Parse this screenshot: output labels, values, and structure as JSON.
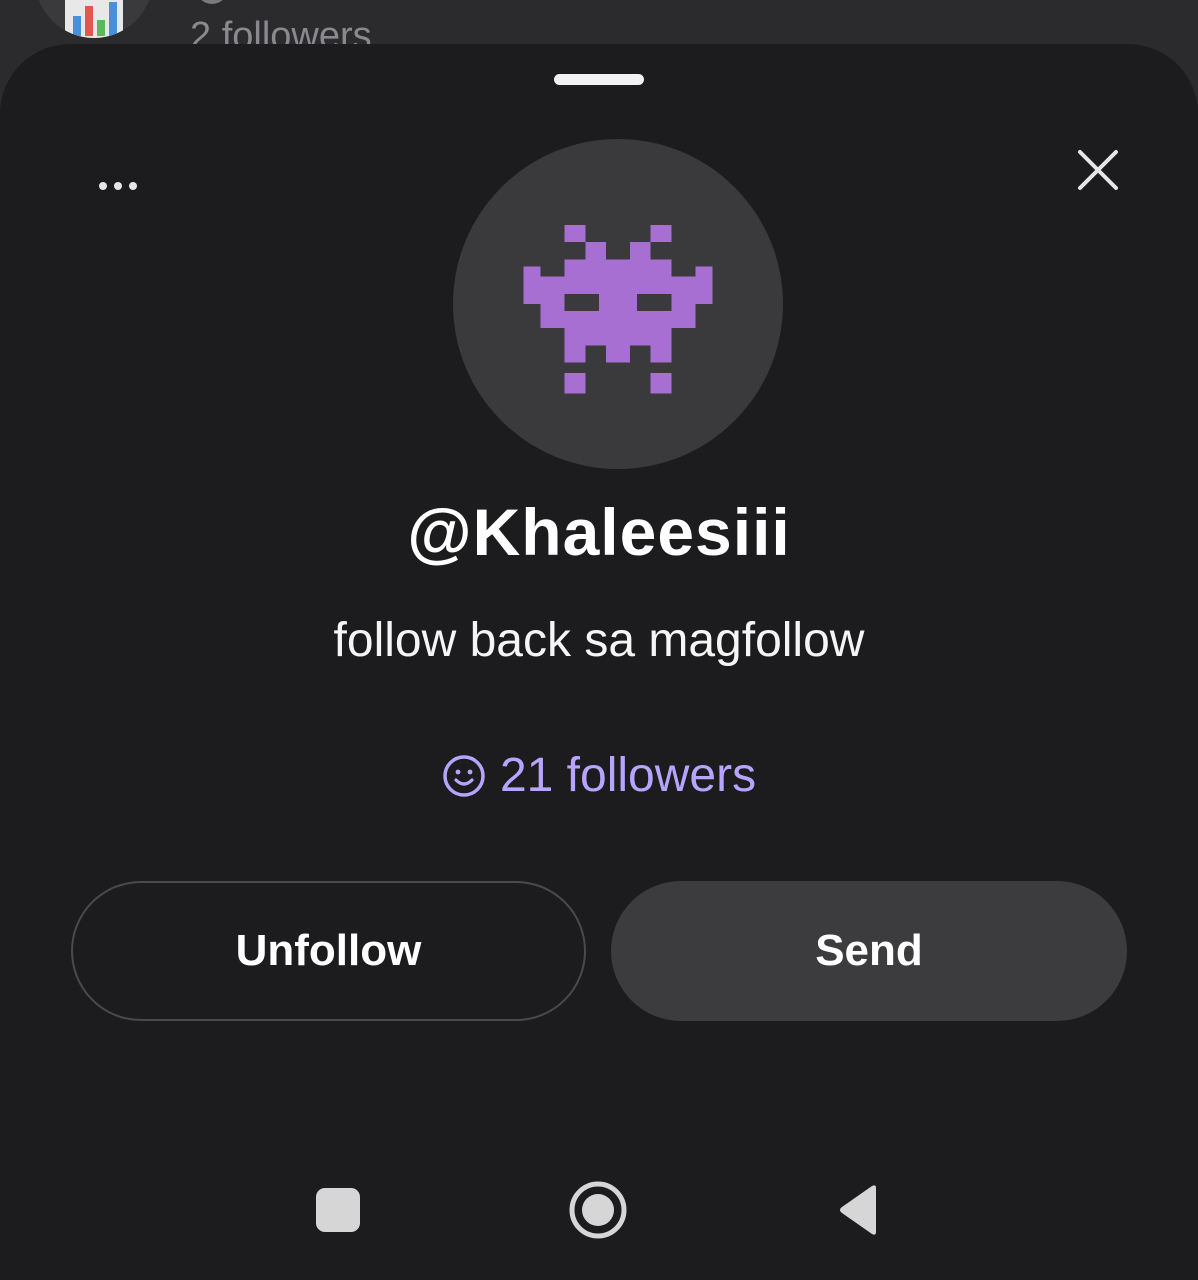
{
  "background": {
    "followers_text": "2 followers"
  },
  "profile": {
    "username": "@Khaleesiii",
    "bio": "follow back sa magfollow",
    "followers_count": "21 followers",
    "avatar_icon": "alien-monster-icon",
    "accent_color": "#b7a4ff",
    "avatar_color": "#a66fd1"
  },
  "actions": {
    "more_icon": "more-dots-icon",
    "close_icon": "close-icon",
    "unfollow_label": "Unfollow",
    "send_label": "Send"
  },
  "navbar": {
    "recents_icon": "square-icon",
    "home_icon": "circle-home-icon",
    "back_icon": "triangle-back-icon"
  }
}
